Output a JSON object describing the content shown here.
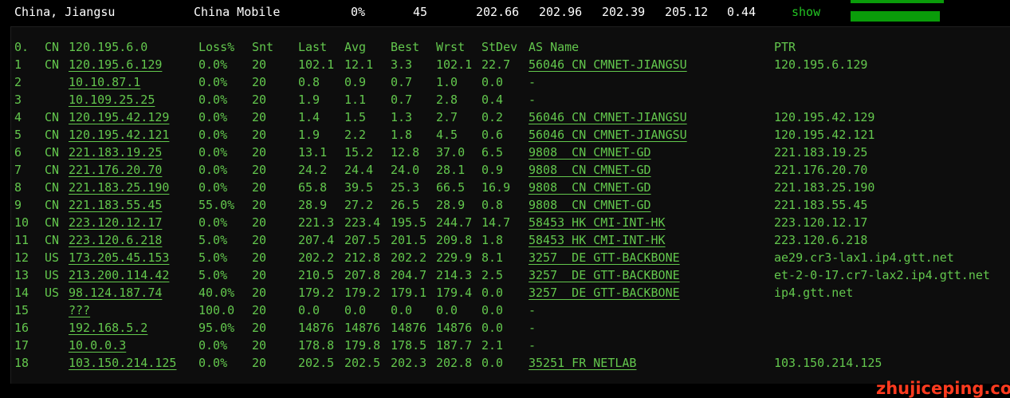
{
  "summary": {
    "location": "China, Jiangsu",
    "isp": "China Mobile",
    "loss": "0%",
    "sent": "45",
    "last": "202.66",
    "avg": "202.96",
    "best": "202.39",
    "worst": "205.12",
    "stdev": "0.44",
    "show_label": "show",
    "bar_color": "#0a9c0a"
  },
  "header": {
    "idx": "0.",
    "cc": "CN",
    "ip": "120.195.6.0",
    "loss": "Loss%",
    "snt": "Snt",
    "last": "Last",
    "avg": "Avg",
    "best": "Best",
    "wrst": "Wrst",
    "stdev": "StDev",
    "as_name": "AS Name",
    "ptr": "PTR"
  },
  "hops": [
    {
      "idx": "1",
      "cc": "CN",
      "ip": "120.195.6.129",
      "loss": "0.0%",
      "snt": "20",
      "last": "102.1",
      "avg": "12.1",
      "best": "3.3",
      "wrst": "102.1",
      "stdev": "22.7",
      "as_name": "56046 CN CMNET-JIANGSU",
      "ptr": "120.195.6.129"
    },
    {
      "idx": "2",
      "cc": "",
      "ip": "10.10.87.1",
      "loss": "0.0%",
      "snt": "20",
      "last": "0.8",
      "avg": "0.9",
      "best": "0.7",
      "wrst": "1.0",
      "stdev": "0.0",
      "as_name": "-",
      "ptr": ""
    },
    {
      "idx": "3",
      "cc": "",
      "ip": "10.109.25.25",
      "loss": "0.0%",
      "snt": "20",
      "last": "1.9",
      "avg": "1.1",
      "best": "0.7",
      "wrst": "2.8",
      "stdev": "0.4",
      "as_name": "-",
      "ptr": ""
    },
    {
      "idx": "4",
      "cc": "CN",
      "ip": "120.195.42.129",
      "loss": "0.0%",
      "snt": "20",
      "last": "1.4",
      "avg": "1.5",
      "best": "1.3",
      "wrst": "2.7",
      "stdev": "0.2",
      "as_name": "56046 CN CMNET-JIANGSU",
      "ptr": "120.195.42.129"
    },
    {
      "idx": "5",
      "cc": "CN",
      "ip": "120.195.42.121",
      "loss": "0.0%",
      "snt": "20",
      "last": "1.9",
      "avg": "2.2",
      "best": "1.8",
      "wrst": "4.5",
      "stdev": "0.6",
      "as_name": "56046 CN CMNET-JIANGSU",
      "ptr": "120.195.42.121"
    },
    {
      "idx": "6",
      "cc": "CN",
      "ip": "221.183.19.25",
      "loss": "0.0%",
      "snt": "20",
      "last": "13.1",
      "avg": "15.2",
      "best": "12.8",
      "wrst": "37.0",
      "stdev": "6.5",
      "as_name": "9808  CN CMNET-GD",
      "ptr": "221.183.19.25"
    },
    {
      "idx": "7",
      "cc": "CN",
      "ip": "221.176.20.70",
      "loss": "0.0%",
      "snt": "20",
      "last": "24.2",
      "avg": "24.4",
      "best": "24.0",
      "wrst": "28.1",
      "stdev": "0.9",
      "as_name": "9808  CN CMNET-GD",
      "ptr": "221.176.20.70"
    },
    {
      "idx": "8",
      "cc": "CN",
      "ip": "221.183.25.190",
      "loss": "0.0%",
      "snt": "20",
      "last": "65.8",
      "avg": "39.5",
      "best": "25.3",
      "wrst": "66.5",
      "stdev": "16.9",
      "as_name": "9808  CN CMNET-GD",
      "ptr": "221.183.25.190"
    },
    {
      "idx": "9",
      "cc": "CN",
      "ip": "221.183.55.45",
      "loss": "55.0%",
      "snt": "20",
      "last": "28.9",
      "avg": "27.2",
      "best": "26.5",
      "wrst": "28.9",
      "stdev": "0.8",
      "as_name": "9808  CN CMNET-GD",
      "ptr": "221.183.55.45"
    },
    {
      "idx": "10",
      "cc": "CN",
      "ip": "223.120.12.17",
      "loss": "0.0%",
      "snt": "20",
      "last": "221.3",
      "avg": "223.4",
      "best": "195.5",
      "wrst": "244.7",
      "stdev": "14.7",
      "as_name": "58453 HK CMI-INT-HK",
      "ptr": "223.120.12.17"
    },
    {
      "idx": "11",
      "cc": "CN",
      "ip": "223.120.6.218",
      "loss": "5.0%",
      "snt": "20",
      "last": "207.4",
      "avg": "207.5",
      "best": "201.5",
      "wrst": "209.8",
      "stdev": "1.8",
      "as_name": "58453 HK CMI-INT-HK",
      "ptr": "223.120.6.218"
    },
    {
      "idx": "12",
      "cc": "US",
      "ip": "173.205.45.153",
      "loss": "5.0%",
      "snt": "20",
      "last": "202.2",
      "avg": "212.8",
      "best": "202.2",
      "wrst": "229.9",
      "stdev": "8.1",
      "as_name": "3257  DE GTT-BACKBONE",
      "ptr": "ae29.cr3-lax1.ip4.gtt.net"
    },
    {
      "idx": "13",
      "cc": "US",
      "ip": "213.200.114.42",
      "loss": "5.0%",
      "snt": "20",
      "last": "210.5",
      "avg": "207.8",
      "best": "204.7",
      "wrst": "214.3",
      "stdev": "2.5",
      "as_name": "3257  DE GTT-BACKBONE",
      "ptr": "et-2-0-17.cr7-lax2.ip4.gtt.net"
    },
    {
      "idx": "14",
      "cc": "US",
      "ip": "98.124.187.74",
      "loss": "40.0%",
      "snt": "20",
      "last": "179.2",
      "avg": "179.2",
      "best": "179.1",
      "wrst": "179.4",
      "stdev": "0.0",
      "as_name": "3257  DE GTT-BACKBONE",
      "ptr": "ip4.gtt.net"
    },
    {
      "idx": "15",
      "cc": "",
      "ip": "???",
      "loss": "100.0",
      "snt": "20",
      "last": "0.0",
      "avg": "0.0",
      "best": "0.0",
      "wrst": "0.0",
      "stdev": "0.0",
      "as_name": "-",
      "ptr": ""
    },
    {
      "idx": "16",
      "cc": "",
      "ip": "192.168.5.2",
      "loss": "95.0%",
      "snt": "20",
      "last": "14876",
      "avg": "14876",
      "best": "14876",
      "wrst": "14876",
      "stdev": "0.0",
      "as_name": "-",
      "ptr": ""
    },
    {
      "idx": "17",
      "cc": "",
      "ip": "10.0.0.3",
      "loss": "0.0%",
      "snt": "20",
      "last": "178.8",
      "avg": "179.8",
      "best": "178.5",
      "wrst": "187.7",
      "stdev": "2.1",
      "as_name": "-",
      "ptr": ""
    },
    {
      "idx": "18",
      "cc": "",
      "ip": "103.150.214.125",
      "loss": "0.0%",
      "snt": "20",
      "last": "202.5",
      "avg": "202.5",
      "best": "202.3",
      "wrst": "202.8",
      "stdev": "0.0",
      "as_name": "35251 FR NETLAB",
      "ptr": "103.150.214.125"
    }
  ],
  "watermark": "zhujiceping.com",
  "colors": {
    "text_green": "#63c74d",
    "show_green": "#22c322",
    "watermark_red": "#ff3b1f"
  }
}
